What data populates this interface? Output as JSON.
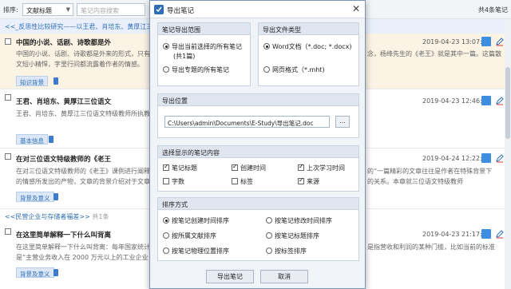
{
  "toolbar": {
    "sort_label": "排序:",
    "sort_value": "文献标题",
    "search_placeholder": "笔记内容搜索",
    "count": "共4条笔记"
  },
  "list": {
    "group1": {
      "label": "<<_反思性比较研究——以王君、肖培东、黄厚江三位语文...",
      "suffix": ""
    },
    "notes": [
      {
        "title": "中国的小说、话剧、诗歌都是外",
        "time": "2019-04-23 13:07:53",
        "snippet": "中国的小说、话剧、诗歌都是外来的形式，只有散文是正宗，对散文，我们只有",
        "snippet_right": "念，杨绛先生的《老王》就是其中一篇。这篇散",
        "snippet2": "文短小精悍，字里行间都流露着作者的情感。",
        "tag": "知识背景"
      },
      {
        "title": "王君、肖培东、黄厚江三位语文",
        "time": "2019-04-23 12:46:58",
        "snippet": "王君、肖培东、黄厚江三位语文特级教师所执教",
        "tag": "基本信息"
      },
      {
        "title": "在对三位语文特级教师的《老王",
        "time": "2019-04-24 12:22:26",
        "snippet": "在对三位语文特级教师的《老王》课例进行阐释",
        "snippet_right": "的“一篇精彩的文章往往是作者在特殊背景下",
        "snippet2": "的情感所发出的产物，文章的背景介绍对于文章的理解",
        "snippet2_right": "的关系。本章就三位语文特级教师",
        "tag": "背景及意义"
      }
    ],
    "group2": {
      "label": "<<民营企业与存储者福差>>",
      "suffix": "共1条"
    },
    "note4": {
      "title": "在这里简单解释一下什么叫背离",
      "time": "2019-04-23 21:17:08",
      "snippet": "在这里简单解释一下什么叫背离：每年国家统计",
      "snippet_right": "是指营收和利润的某种门槛，比如当前的标准",
      "snippet2": "是“主营业务收入在 2000 万元以上的工业企业",
      "tag": "背景及意义"
    }
  },
  "modal": {
    "title": "导出笔记",
    "scope": {
      "header": "笔记导出范围",
      "opt1": "导出当前选择的所有笔记",
      "opt1_sub": "(共1篇)",
      "opt2": "导出专题的所有笔记"
    },
    "filetype": {
      "header": "导出文件类型",
      "opt1": "Word文档（*.doc; *.docx)",
      "opt2": "网页格式（*.mht)"
    },
    "location": {
      "header": "导出位置",
      "path": "C:\\Users\\admin\\Documents\\E-Study\\导出笔记.doc",
      "browse": "..."
    },
    "fields": {
      "header": "选择显示的笔记内容",
      "items": [
        {
          "label": "笔记标题",
          "checked": true
        },
        {
          "label": "创建时间",
          "checked": true
        },
        {
          "label": "上次学习时间",
          "checked": true
        },
        {
          "label": "字数",
          "checked": false
        },
        {
          "label": "标签",
          "checked": false
        },
        {
          "label": "来源",
          "checked": true
        }
      ]
    },
    "sort": {
      "header": "排序方式",
      "items": [
        {
          "label": "按笔记创建时间排序",
          "checked": true
        },
        {
          "label": "按笔记修改时间排序",
          "checked": false
        },
        {
          "label": "按所属文献排序",
          "checked": false
        },
        {
          "label": "按笔记标题排序",
          "checked": false
        },
        {
          "label": "按笔记物理位置排序",
          "checked": false
        },
        {
          "label": "按标签排序",
          "checked": false
        }
      ]
    },
    "buttons": {
      "export": "导出笔记",
      "cancel": "取消"
    }
  }
}
